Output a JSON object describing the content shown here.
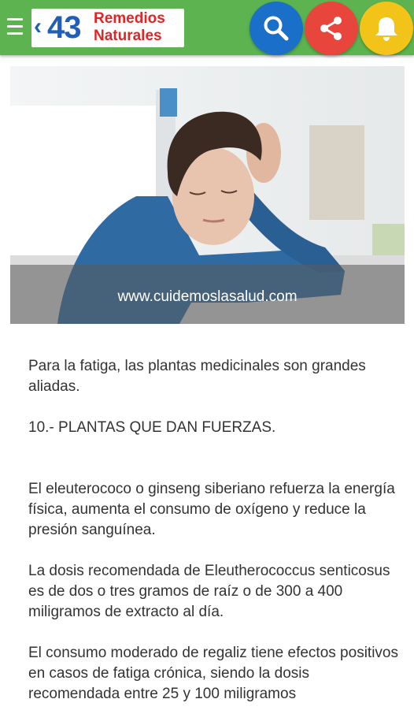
{
  "appbar": {
    "logo": {
      "arrow": "‹",
      "number": "43",
      "line1": "Remedios",
      "line2": "Naturales"
    }
  },
  "icons": {
    "menu": "hamburger-menu-icon",
    "search": "search-icon",
    "share": "share-icon",
    "notifications": "bell-icon"
  },
  "colors": {
    "appbar": "#5cb34f",
    "search_button": "#1a6fc9",
    "share_button": "#e8463c",
    "bell_button": "#f2c318",
    "logo_number": "#1f5fb5",
    "logo_text": "#e32424",
    "body_text": "#333333"
  },
  "hero": {
    "caption": "www.cuidemoslasalud.com"
  },
  "article": {
    "paragraphs": [
      "Para la fatiga, las plantas medicinales son grandes aliadas.",
      "10.- PLANTAS QUE DAN FUERZAS.",
      "El eleuterococo o ginseng siberiano refuerza la energía física, aumenta el consumo de oxígeno y reduce la presión sanguínea.",
      "La dosis recomendada de Eleutherococcus senticosus es de dos o tres gramos de raíz o de 300 a 400 miligramos de extracto al día.",
      "El consumo moderado de regaliz tiene efectos positivos en casos de fatiga crónica, siendo la dosis recomendada entre 25 y 100 miligramos"
    ]
  }
}
